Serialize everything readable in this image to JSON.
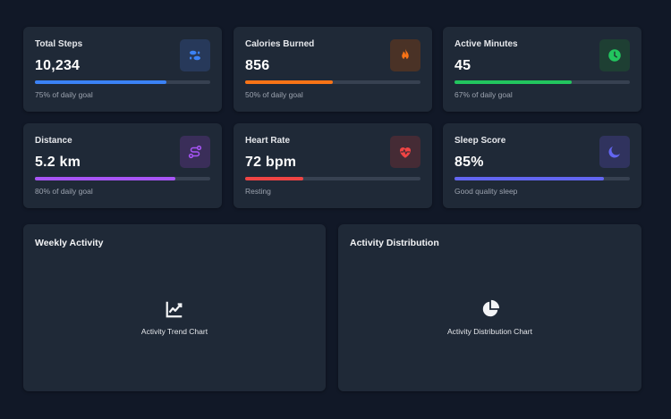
{
  "stats": [
    {
      "label": "Total Steps",
      "value": "10,234",
      "sub": "75% of daily goal",
      "progress": 0.75,
      "color": "#3b82f6",
      "icon_bg": "#27395a",
      "icon_color": "#3b82f6",
      "icon": "footsteps-icon"
    },
    {
      "label": "Calories Burned",
      "value": "856",
      "sub": "50% of daily goal",
      "progress": 0.5,
      "color": "#f97316",
      "icon_bg": "#4a3226",
      "icon_color": "#f97316",
      "icon": "flame-icon"
    },
    {
      "label": "Active Minutes",
      "value": "45",
      "sub": "67% of daily goal",
      "progress": 0.67,
      "color": "#22c55e",
      "icon_bg": "#1e3f33",
      "icon_color": "#22c55e",
      "icon": "clock-icon"
    },
    {
      "label": "Distance",
      "value": "5.2 km",
      "sub": "80% of daily goal",
      "progress": 0.8,
      "color": "#a855f7",
      "icon_bg": "#3a2e59",
      "icon_color": "#a855f7",
      "icon": "route-icon"
    },
    {
      "label": "Heart Rate",
      "value": "72 bpm",
      "sub": "Resting",
      "progress": 0.33,
      "color": "#ef4444",
      "icon_bg": "#452b35",
      "icon_color": "#ef4444",
      "icon": "heartbeat-icon"
    },
    {
      "label": "Sleep Score",
      "value": "85%",
      "sub": "Good quality sleep",
      "progress": 0.85,
      "color": "#6366f1",
      "icon_bg": "#30335e",
      "icon_color": "#6366f1",
      "icon": "moon-icon"
    }
  ],
  "panels": [
    {
      "title": "Weekly Activity",
      "placeholder": "Activity Trend Chart",
      "icon": "line-chart-icon"
    },
    {
      "title": "Activity Distribution",
      "placeholder": "Activity Distribution Chart",
      "icon": "pie-chart-icon"
    }
  ]
}
